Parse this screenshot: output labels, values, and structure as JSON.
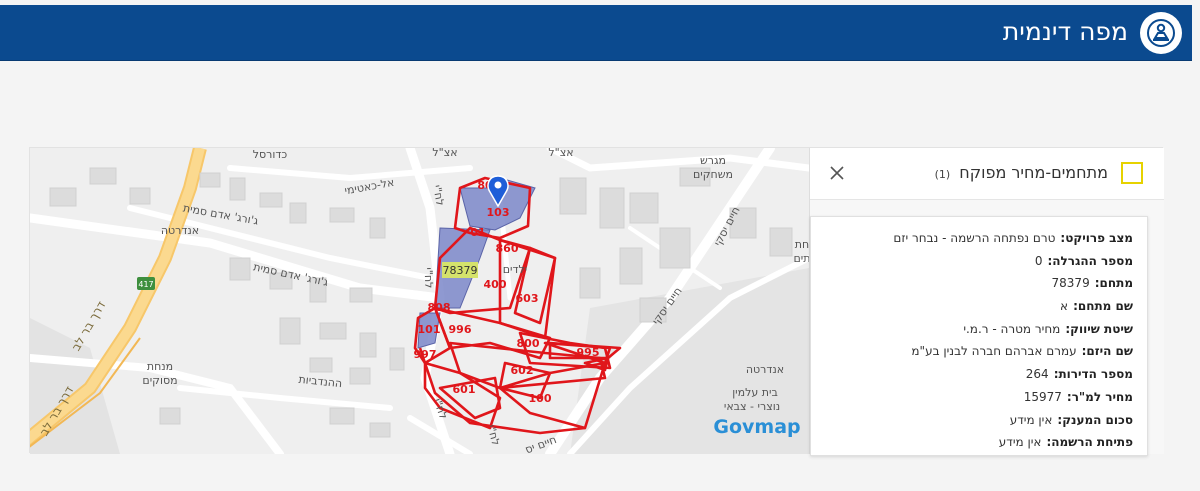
{
  "header": {
    "title": "מפה דינמית",
    "logo_icon": "map-pin-person-icon",
    "bg_color": "#0b4a8f"
  },
  "map": {
    "street_labels": [
      "כדורסל",
      "אצ\"ל",
      "אצ\"ל",
      "אל-כאטימי",
      "ג'ורג' אדם סמית",
      "ג'ורג' אדם סמית",
      "אנדרטה",
      "לח\"י",
      "לח\"י",
      "לח\"י",
      "חיים יסקי",
      "חיים יסקי",
      "אנדרטה",
      "ההנדביות",
      "מנחת",
      "מסוקים",
      "דרך בר לב",
      "דרך בר לב",
      "מגרש",
      "משחקים",
      "בית עלמין",
      "נוצרי - צבאי",
      "לח\"י",
      "חיים יס",
      "חת",
      "תים",
      "ילדים"
    ],
    "road_number": "417",
    "parcels": [
      "103",
      "860",
      "400",
      "603",
      "808",
      "101",
      "996",
      "800",
      "995",
      "997",
      "602",
      "601",
      "100"
    ],
    "highlighted_parcel": "78379",
    "small_parcels": [
      "80",
      "01"
    ],
    "watermark": "Govmap",
    "outline_color": "#e0161b",
    "fill_color": "#7b87c9"
  },
  "panel": {
    "title": "מתחמים-מחיר מפוקח",
    "count": "(1)",
    "legend_color": "#e6d200",
    "fields": [
      {
        "label": "מצב פרויקט:",
        "value": "טרם נפתחה הרשמה - נבחר יזם"
      },
      {
        "label": "מספר ההגרלה:",
        "value": "0"
      },
      {
        "label": "מתחם:",
        "value": "78379"
      },
      {
        "label": "שם מתחם:",
        "value": "א"
      },
      {
        "label": "שיטת שיווק:",
        "value": "מחיר מטרה - ר.מ.י"
      },
      {
        "label": "שם היזם:",
        "value": "עמרם אברהם חברה לבנין בע\"מ"
      },
      {
        "label": "מספר הדירות:",
        "value": "264"
      },
      {
        "label": "מחיר למ\"ר:",
        "value": "15977"
      },
      {
        "label": "סכום המענק:",
        "value": "אין מידע"
      },
      {
        "label": "פתיחת הרשמה:",
        "value": "אין מידע"
      }
    ]
  }
}
